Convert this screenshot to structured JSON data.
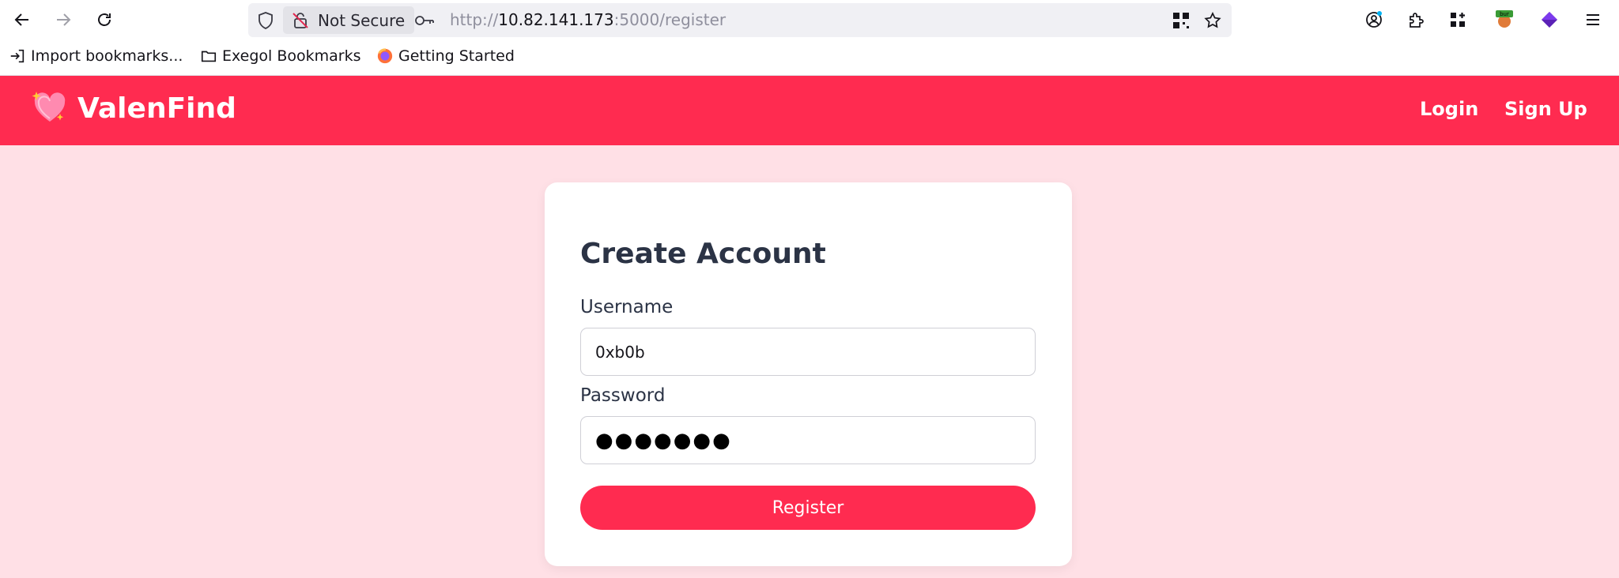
{
  "browser": {
    "security_label": "Not Secure",
    "url": {
      "scheme": "http://",
      "host": "10.82.141.173",
      "rest": ":5000/register"
    },
    "extension_badge": "bur",
    "bookmarks": [
      "Import bookmarks...",
      "Exegol Bookmarks",
      "Getting Started"
    ]
  },
  "app": {
    "brand": "ValenFind",
    "nav": {
      "login": "Login",
      "signup": "Sign Up"
    },
    "colors": {
      "accent": "#ff2b50",
      "background": "#ffe0e6"
    }
  },
  "form": {
    "title": "Create Account",
    "username_label": "Username",
    "username_value": "0xb0b",
    "password_label": "Password",
    "password_masked": "●●●●●●●",
    "submit_label": "Register"
  }
}
